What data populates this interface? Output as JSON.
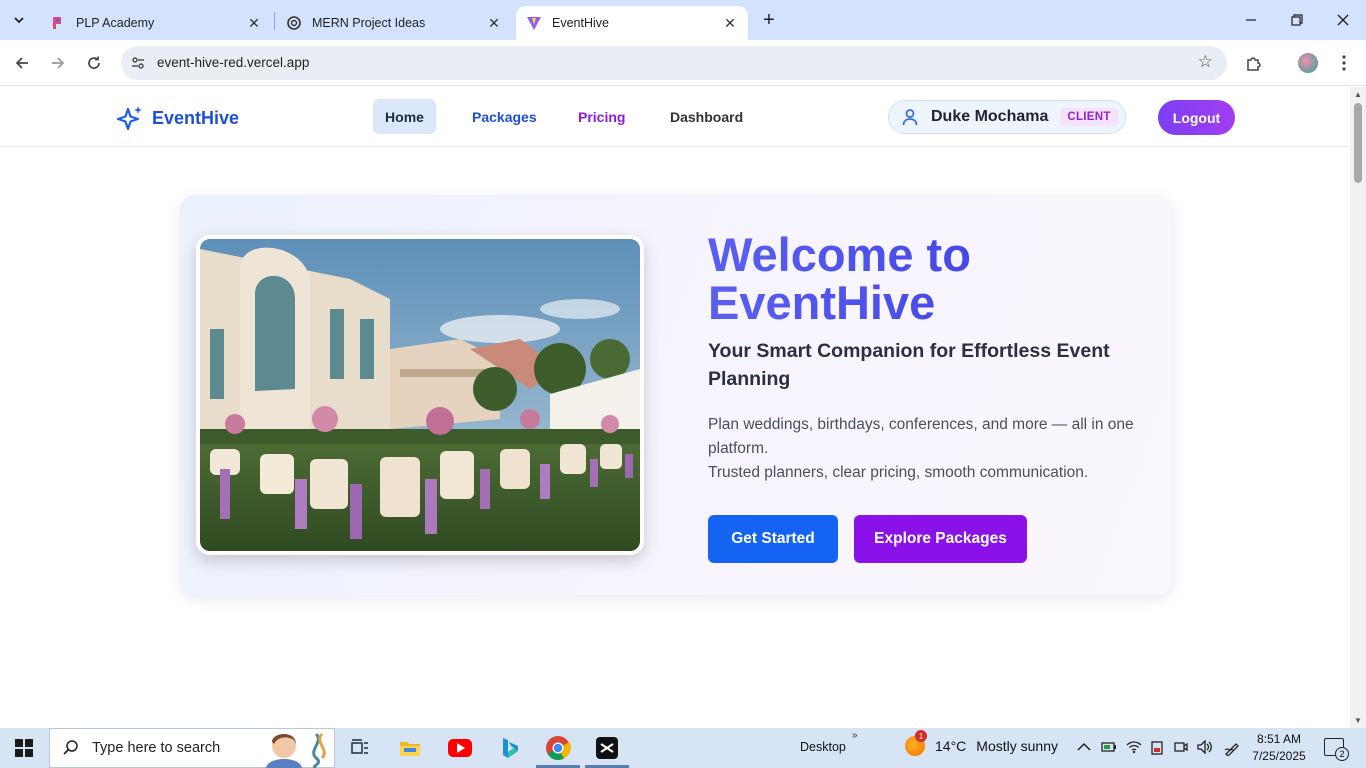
{
  "browser": {
    "tabs": [
      {
        "title": "PLP Academy",
        "icon": "plp-icon"
      },
      {
        "title": "MERN Project Ideas",
        "icon": "openai-icon"
      },
      {
        "title": "EventHive",
        "icon": "vite-icon",
        "active": true
      }
    ],
    "url": "event-hive-red.vercel.app"
  },
  "app": {
    "brand": "EventHive",
    "nav": {
      "home": "Home",
      "packages": "Packages",
      "pricing": "Pricing",
      "dashboard": "Dashboard"
    },
    "user": {
      "name": "Duke Mochama",
      "role": "CLIENT"
    },
    "logout": "Logout"
  },
  "hero": {
    "title_line1": "Welcome to",
    "title_line2": "EventHive",
    "subtitle": "Your Smart Companion for Effortless Event Planning",
    "desc_line1": "Plan weddings, birthdays, conferences, and more — all in one platform.",
    "desc_line2": "Trusted planners, clear pricing, smooth communication.",
    "primary_button": "Get Started",
    "secondary_button": "Explore Packages"
  },
  "taskbar": {
    "search_placeholder": "Type here to search",
    "desktop_label": "Desktop",
    "weather_badge": "1",
    "temperature": "14°C",
    "condition": "Mostly sunny",
    "time": "8:51 AM",
    "date": "7/25/2025",
    "notification_count": "2"
  },
  "colors": {
    "primary_blue": "#1463f3",
    "brand_purple": "#8a12e8",
    "nav_blue": "#1e4fd8"
  }
}
